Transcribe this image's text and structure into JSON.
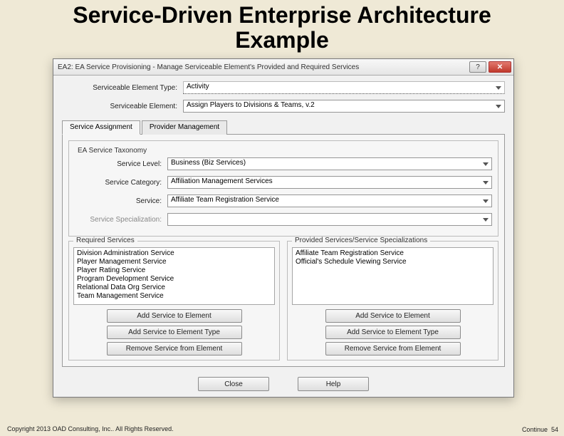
{
  "slide_title_line1": "Service-Driven Enterprise Architecture",
  "slide_title_line2": "Example",
  "titlebar": "EA2: EA Service Provisioning - Manage Serviceable Element's Provided and Required Services",
  "top": {
    "type_label": "Serviceable Element Type:",
    "type_value": "Activity",
    "element_label": "Serviceable Element:",
    "element_value": "Assign Players to Divisions & Teams, v.2"
  },
  "tabs": {
    "active": "Service Assignment",
    "inactive": "Provider Management"
  },
  "taxonomy": {
    "group_title": "EA Service Taxonomy",
    "level_label": "Service Level:",
    "level_value": "Business (Biz Services)",
    "category_label": "Service Category:",
    "category_value": "Affiliation Management Services",
    "service_label": "Service:",
    "service_value": "Affiliate Team Registration Service",
    "specialization_label": "Service Specialization:",
    "specialization_value": ""
  },
  "required": {
    "title": "Required Services",
    "items": [
      "Division Administration Service",
      "Player Management Service",
      "Player Rating Service",
      "Program Development Service",
      "Relational Data Org Service",
      "Team Management Service"
    ],
    "btn_add_elem": "Add Service to Element",
    "btn_add_type": "Add Service to Element Type",
    "btn_remove": "Remove Service from Element"
  },
  "provided": {
    "title": "Provided Services/Service Specializations",
    "items": [
      "Affiliate Team Registration Service",
      "Official's Schedule Viewing Service"
    ],
    "btn_add_elem": "Add Service to Element",
    "btn_add_type": "Add Service to Element Type",
    "btn_remove": "Remove Service from Element"
  },
  "bottom": {
    "close": "Close",
    "help": "Help"
  },
  "footer": {
    "copyright": "Copyright 2013 OAD Consulting, Inc.. All Rights Reserved.",
    "continue": "Continue",
    "pagenum": "54"
  }
}
